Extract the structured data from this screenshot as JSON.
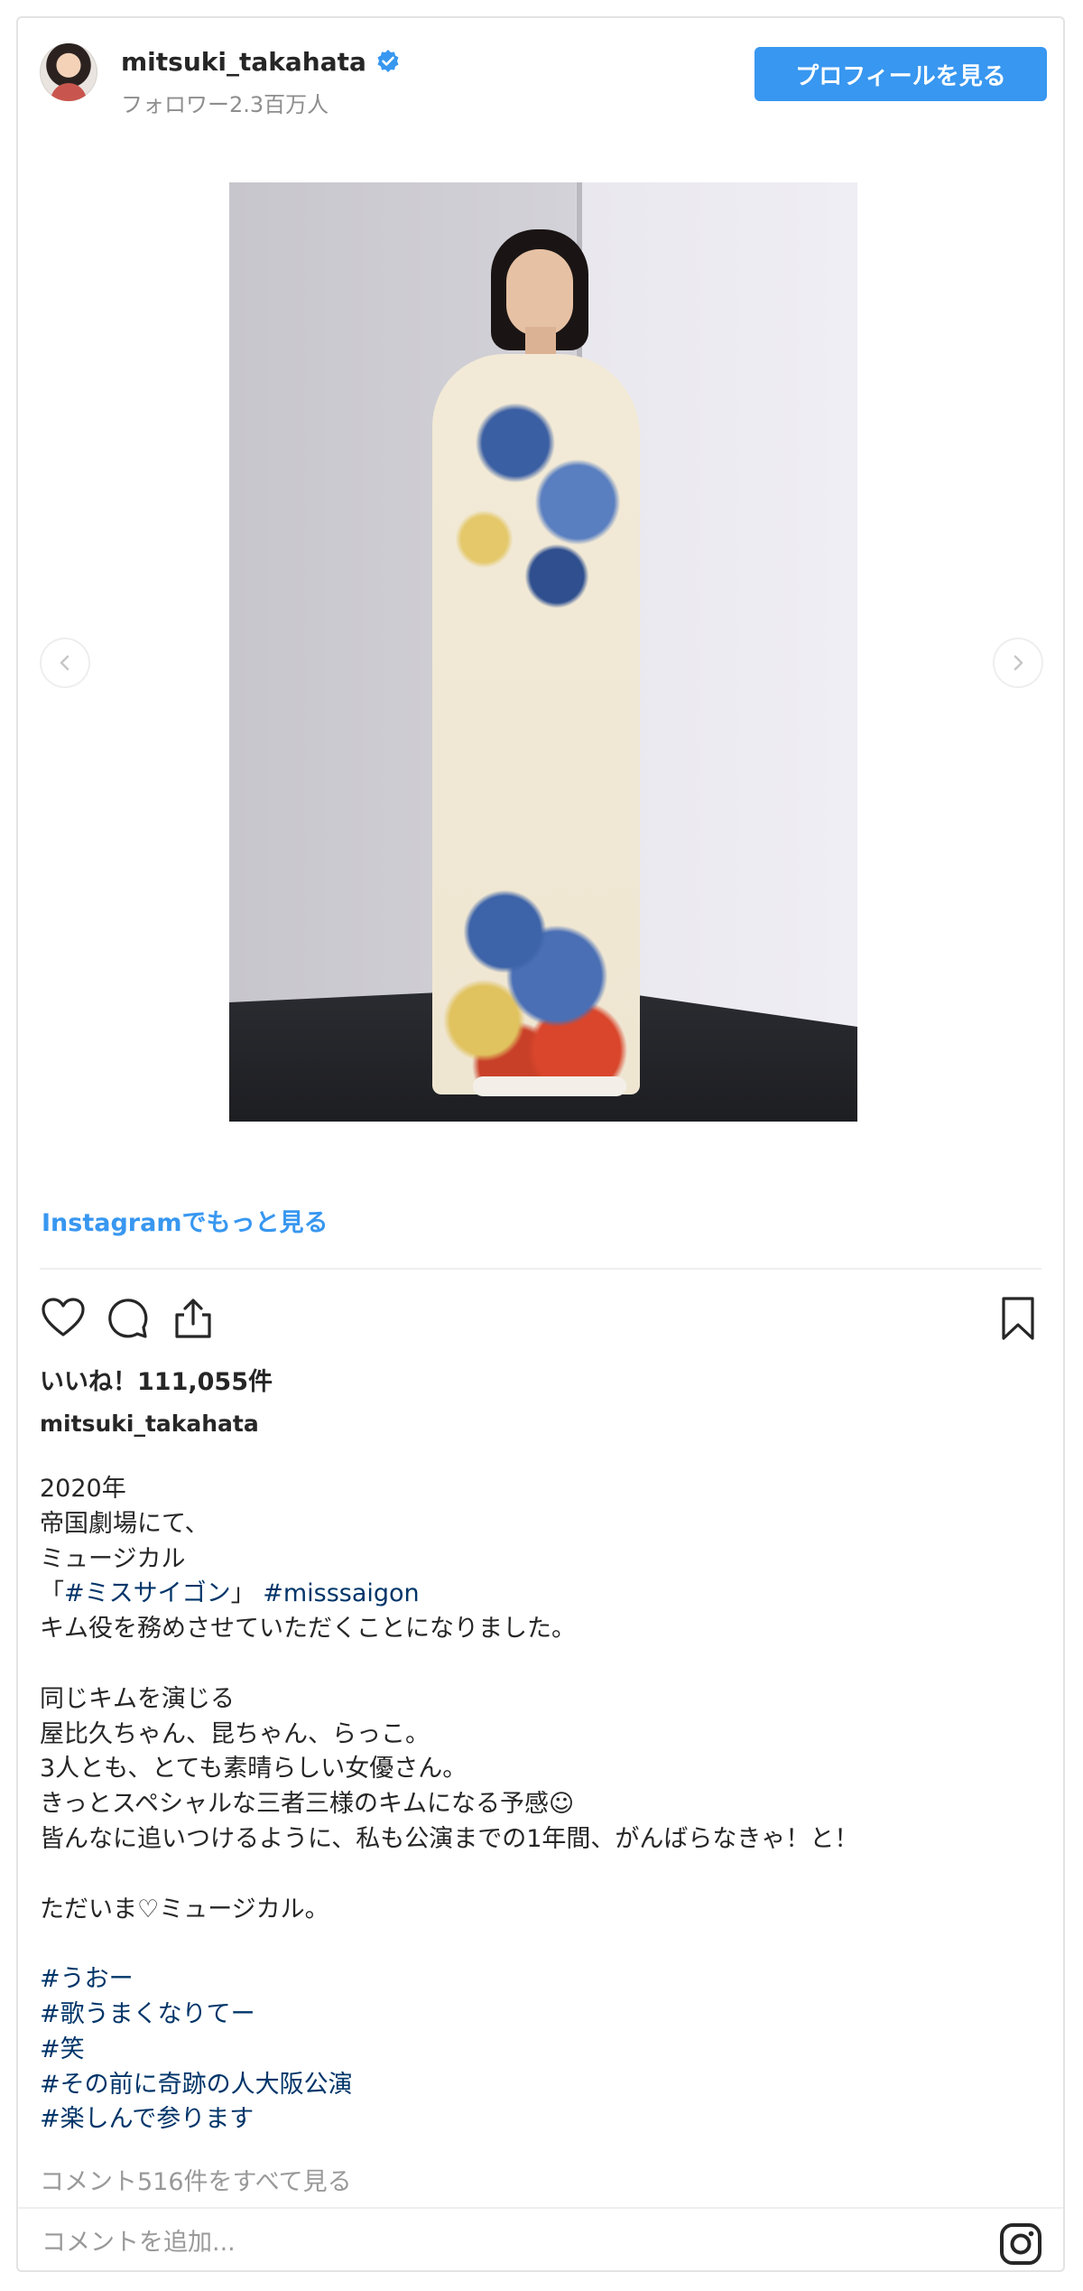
{
  "header": {
    "username": "mitsuki_takahata",
    "followers": "フォロワー2.3百万人",
    "profile_button": "プロフィールを見る",
    "verified_color": "#3897f0"
  },
  "more_link": "Instagramでもっと見る",
  "likes": "いいね！111,055件",
  "caption_user": "mitsuki_takahata",
  "caption_lines": [
    {
      "segments": [
        {
          "text": "2020年",
          "tag": false
        }
      ]
    },
    {
      "segments": [
        {
          "text": "帝国劇場にて、",
          "tag": false
        }
      ]
    },
    {
      "segments": [
        {
          "text": "ミュージカル",
          "tag": false
        }
      ]
    },
    {
      "segments": [
        {
          "text": "「",
          "tag": false
        },
        {
          "text": "#ミスサイゴン",
          "tag": true
        },
        {
          "text": "」 ",
          "tag": false
        },
        {
          "text": "#misssaigon",
          "tag": true
        }
      ]
    },
    {
      "segments": [
        {
          "text": "キム役を務めさせていただくことになりました。",
          "tag": false
        }
      ]
    },
    {
      "segments": [
        {
          "text": "",
          "tag": false
        }
      ]
    },
    {
      "segments": [
        {
          "text": "同じキムを演じる",
          "tag": false
        }
      ]
    },
    {
      "segments": [
        {
          "text": "屋比久ちゃん、昆ちゃん、らっこ。",
          "tag": false
        }
      ]
    },
    {
      "segments": [
        {
          "text": "3人とも、とても素晴らしい女優さん。",
          "tag": false
        }
      ]
    },
    {
      "segments": [
        {
          "text": "きっとスペシャルな三者三様のキムになる予感☺︎",
          "tag": false
        }
      ]
    },
    {
      "segments": [
        {
          "text": "皆んなに追いつけるように、私も公演までの1年間、がんばらなきゃ！と！",
          "tag": false
        }
      ]
    },
    {
      "segments": [
        {
          "text": "",
          "tag": false
        }
      ]
    },
    {
      "segments": [
        {
          "text": "ただいま♡ミュージカル。",
          "tag": false
        }
      ]
    },
    {
      "segments": [
        {
          "text": "",
          "tag": false
        }
      ]
    },
    {
      "segments": [
        {
          "text": "#うおー",
          "tag": true
        }
      ]
    },
    {
      "segments": [
        {
          "text": "#歌うまくなりてー",
          "tag": true
        }
      ]
    },
    {
      "segments": [
        {
          "text": "#笑",
          "tag": true
        }
      ]
    },
    {
      "segments": [
        {
          "text": "#その前に奇跡の人大阪公演",
          "tag": true
        }
      ]
    },
    {
      "segments": [
        {
          "text": "#楽しんで参ります",
          "tag": true
        },
        {
          "text": "",
          "tag": false
        }
      ]
    }
  ],
  "view_comments": "コメント516件をすべて見る",
  "add_comment_placeholder": "コメントを追加...",
  "icons": {
    "verified": "verified-badge-icon",
    "prev": "chevron-left-icon",
    "next": "chevron-right-icon",
    "like": "heart-icon",
    "comment": "comment-bubble-icon",
    "share": "share-icon",
    "bookmark": "bookmark-icon",
    "instagram": "instagram-logo-icon"
  },
  "colors": {
    "link_blue": "#3897f0",
    "hashtag": "#003569",
    "muted": "#999999"
  }
}
